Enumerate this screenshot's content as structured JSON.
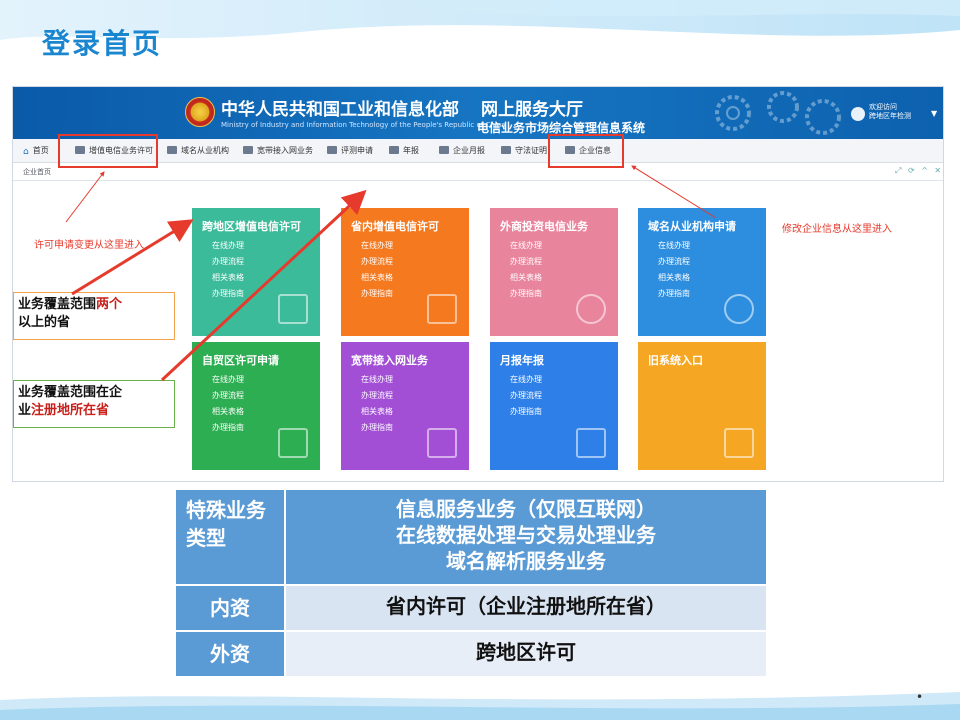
{
  "slide": {
    "title": "登录首页",
    "page_marker": "•"
  },
  "portal": {
    "ministry_cn": "中华人民共和国工业和信息化部",
    "ministry_en": "Ministry of Industry and Information Technology of the People's Republic of China",
    "portal_title": "网上服务大厅",
    "portal_subtitle": "电信业务市场综合管理信息系统",
    "user_line1": "欢迎访问",
    "user_line2": "跨地区年检测",
    "nav": [
      {
        "label": "首页"
      },
      {
        "label": "增值电信业务许可"
      },
      {
        "label": "域名从业机构"
      },
      {
        "label": "宽带接入网业务"
      },
      {
        "label": "评测申请"
      },
      {
        "label": "年报"
      },
      {
        "label": "企业月报"
      },
      {
        "label": "守法证明"
      },
      {
        "label": "企业信息"
      }
    ],
    "sub_label": "企业首页",
    "sub_controls": "⤢ ⟳ ^ ✕"
  },
  "tiles": [
    {
      "title": "跨地区增值电信许可",
      "links": [
        "在线办理",
        "办理流程",
        "相关表格",
        "办理指南"
      ],
      "color": "#3cbb9a"
    },
    {
      "title": "省内增值电信许可",
      "links": [
        "在线办理",
        "办理流程",
        "相关表格",
        "办理指南"
      ],
      "color": "#f5791f"
    },
    {
      "title": "外商投资电信业务",
      "links": [
        "在线办理",
        "办理流程",
        "相关表格",
        "办理指南"
      ],
      "color": "#e9849d"
    },
    {
      "title": "域名从业机构申请",
      "links": [
        "在线办理",
        "办理流程",
        "相关表格",
        "办理指南"
      ],
      "color": "#2d8ee0"
    },
    {
      "title": "自贸区许可申请",
      "links": [
        "在线办理",
        "办理流程",
        "相关表格",
        "办理指南"
      ],
      "color": "#2eae53"
    },
    {
      "title": "宽带接入网业务",
      "links": [
        "在线办理",
        "办理流程",
        "相关表格",
        "办理指南"
      ],
      "color": "#a24fd6"
    },
    {
      "title": "月报年报",
      "links": [
        "在线办理",
        "办理流程",
        "办理指南"
      ],
      "color": "#2e7fe8"
    },
    {
      "title": "旧系统入口",
      "links": [],
      "color": "#f5a623"
    }
  ],
  "annotations": {
    "left_note": "许可申请变更从这里进入",
    "right_note": "修改企业信息从这里进入",
    "callout1_a": "业务覆盖范围",
    "callout1_b": "两个",
    "callout1_c": "以上的省",
    "callout2_a": "业务覆盖范围在企",
    "callout2_b": "业",
    "callout2_c": "注册地所在省",
    "color_red": "#e53a2c"
  },
  "table": {
    "row1_left": "特殊业务类型",
    "row1_right_1": "信息服务业务（仅限互联网）",
    "row1_right_2": "在线数据处理与交易处理业务",
    "row1_right_3": "域名解析服务业务",
    "row2_left": "内资",
    "row2_right": "省内许可（企业注册地所在省）",
    "row3_left": "外资",
    "row3_right": "跨地区许可",
    "color_header": "#5b9bd5",
    "color_light": "#e8eef7"
  }
}
